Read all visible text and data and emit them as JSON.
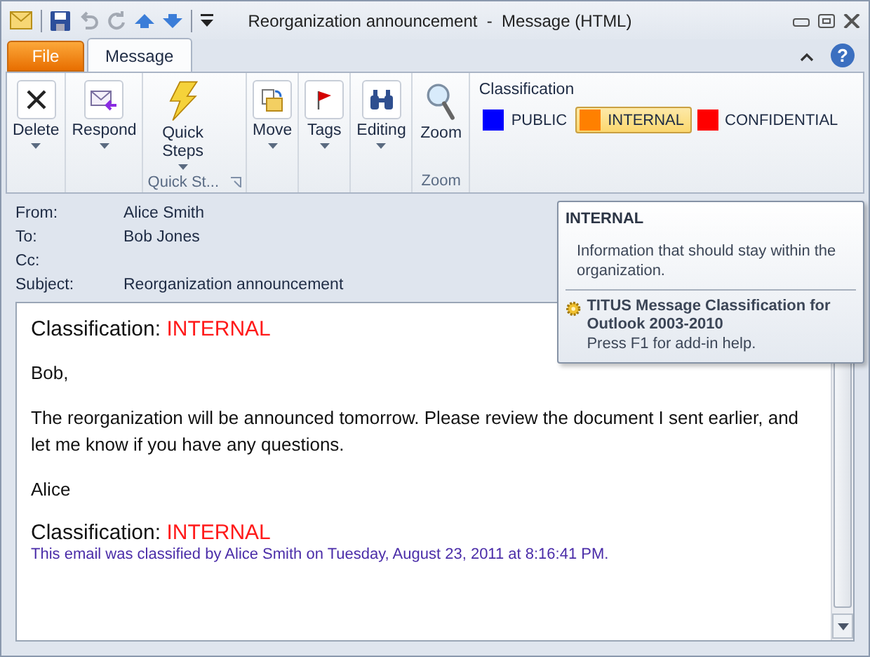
{
  "window": {
    "title": "Reorganization announcement  -  Message (HTML)",
    "help": "?"
  },
  "tabs": [
    {
      "label": "File",
      "kind": "file",
      "selected": false
    },
    {
      "label": "Message",
      "kind": "tab",
      "selected": true
    }
  ],
  "ribbon": {
    "groups": [
      {
        "buttons": [
          {
            "label": "Delete",
            "dropdown": true
          }
        ]
      },
      {
        "buttons": [
          {
            "label": "Respond",
            "dropdown": true
          }
        ]
      },
      {
        "label": "Quick St...",
        "launcher": true,
        "buttons": [
          {
            "label": "Quick Steps",
            "dropdown": true
          }
        ]
      },
      {
        "buttons": [
          {
            "label": "Move",
            "dropdown": true
          }
        ]
      },
      {
        "buttons": [
          {
            "label": "Tags",
            "dropdown": true
          }
        ]
      },
      {
        "buttons": [
          {
            "label": "Editing",
            "dropdown": true
          }
        ]
      },
      {
        "label": "Zoom",
        "buttons": [
          {
            "label": "Zoom",
            "dropdown": false
          }
        ]
      }
    ],
    "classification": {
      "title": "Classification",
      "options": [
        {
          "label": "PUBLIC",
          "color": "#0000ff",
          "selected": false
        },
        {
          "label": "INTERNAL",
          "color": "#ff8000",
          "selected": true
        },
        {
          "label": "CONFIDENTIAL",
          "color": "#ff0000",
          "selected": false
        }
      ]
    }
  },
  "header": [
    {
      "label": "From:",
      "value": "Alice Smith"
    },
    {
      "label": "To:",
      "value": "Bob Jones"
    },
    {
      "label": "Cc:"
    },
    {
      "label": "Subject:",
      "value": "Reorganization announcement"
    }
  ],
  "body": {
    "classification_top": {
      "label": "Classification:",
      "value": "INTERNAL"
    },
    "paragraphs": [
      "Bob,",
      "The reorganization will be announced tomorrow. Please review the document I sent earlier, and let me know if you have any questions.",
      "Alice"
    ],
    "classification_bottom": {
      "label": "Classification:",
      "value": "INTERNAL"
    },
    "note": "This email was classified by Alice Smith on Tuesday, August 23, 2011 at 8:16:41 PM."
  },
  "tooltip": {
    "title": "INTERNAL",
    "description": "Information that should stay within the organization.",
    "addin_title": "TITUS Message Classification for Outlook 2003-2010",
    "addin_help": "Press F1 for add-in help."
  }
}
